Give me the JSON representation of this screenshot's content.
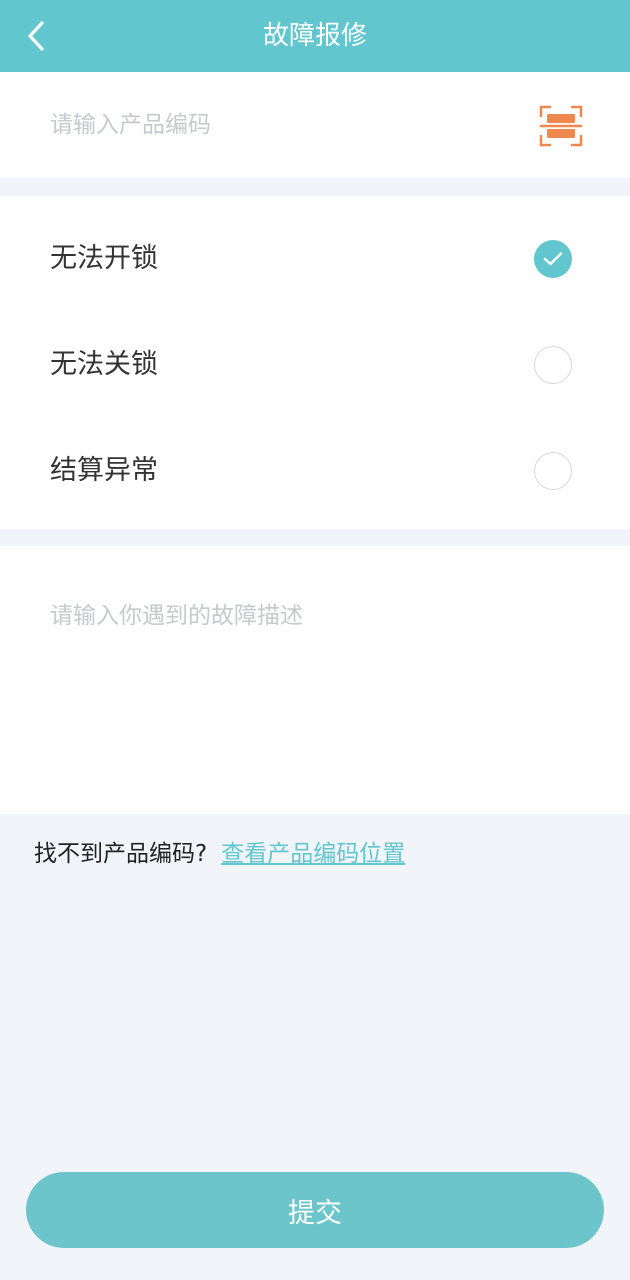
{
  "header": {
    "title": "故障报修",
    "back_icon": "chevron-left-icon",
    "bg_color": "#62c6ce"
  },
  "code_input": {
    "placeholder": "请输入产品编码",
    "value": "",
    "scan_icon": "scan-code-icon",
    "scan_color": "#f0874f"
  },
  "fault_options": [
    {
      "label": "无法开锁",
      "selected": true
    },
    {
      "label": "无法关锁",
      "selected": false
    },
    {
      "label": "结算异常",
      "selected": false
    }
  ],
  "description": {
    "placeholder": "请输入你遇到的故障描述",
    "value": ""
  },
  "hint": {
    "text": "找不到产品编码?",
    "link": "查看产品编码位置"
  },
  "submit": {
    "label": "提交"
  }
}
